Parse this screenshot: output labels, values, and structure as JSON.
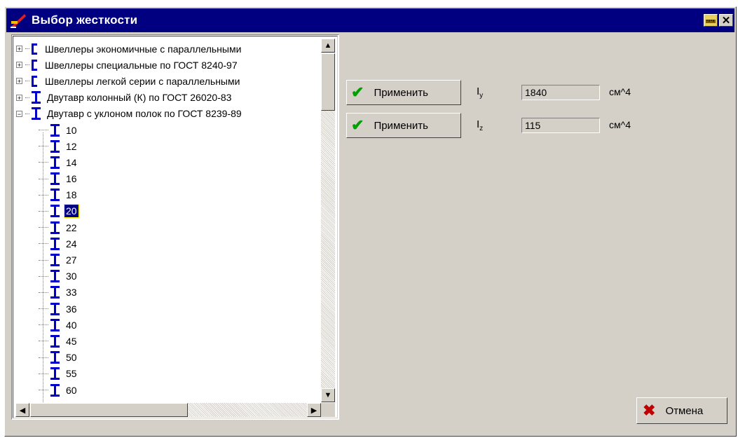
{
  "window": {
    "title": "Выбор жесткости"
  },
  "tree": {
    "groups": [
      {
        "label": "Швеллеры экономичные с параллельными",
        "icon": "channel-icon",
        "expanded": false
      },
      {
        "label": "Швеллеры специальные  по ГОСТ 8240-97",
        "icon": "channel-icon",
        "expanded": false
      },
      {
        "label": "Швеллеры легкой серии с параллельными",
        "icon": "channel-icon",
        "expanded": false
      },
      {
        "label": "Двутавр колонный (К) по ГОСТ 26020-83",
        "icon": "i-beam-icon",
        "expanded": false
      },
      {
        "label": "Двутавр с уклоном полок по ГОСТ 8239-89",
        "icon": "i-beam-icon",
        "expanded": true
      }
    ],
    "children": [
      "10",
      "12",
      "14",
      "16",
      "18",
      "20",
      "22",
      "24",
      "27",
      "30",
      "33",
      "36",
      "40",
      "45",
      "50",
      "55",
      "60"
    ],
    "selected": "20"
  },
  "stiffness": {
    "iy": {
      "button_label": "Применить",
      "symbol": "I",
      "subscript": "y",
      "value": "1840",
      "unit": "см^4"
    },
    "iz": {
      "button_label": "Применить",
      "symbol": "I",
      "subscript": "z",
      "value": "115",
      "unit": "см^4"
    }
  },
  "cancel_label": "Отмена",
  "colors": {
    "titlebar": "#000080",
    "selection": "#000080",
    "icon_blue": "#0000c8",
    "check": "#00a000",
    "cancel_x": "#c00000"
  }
}
